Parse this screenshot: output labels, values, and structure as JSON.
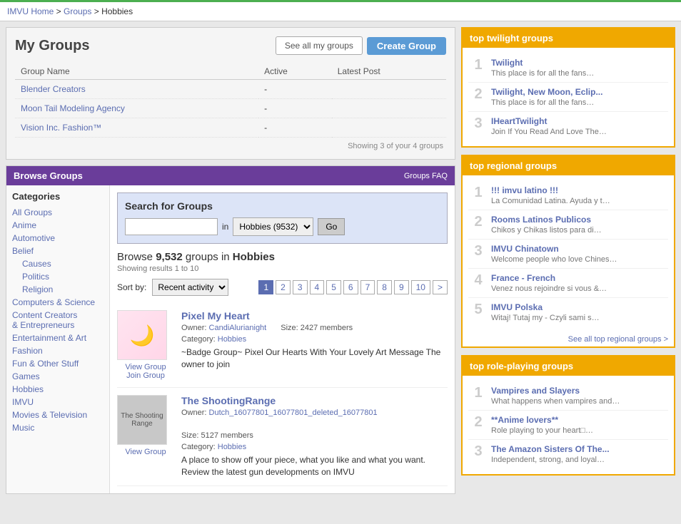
{
  "topbar_color": "#4caf50",
  "breadcrumb": {
    "home": "IMVU Home",
    "groups": "Groups",
    "current": "Hobbies"
  },
  "my_groups": {
    "title": "My Groups",
    "btn_see_all": "See all my groups",
    "btn_create": "Create Group",
    "table": {
      "col_name": "Group Name",
      "col_active": "Active",
      "col_latest": "Latest Post",
      "rows": [
        {
          "name": "Blender Creators",
          "active": "-",
          "latest": ""
        },
        {
          "name": "Moon Tail Modeling Agency",
          "active": "-",
          "latest": ""
        },
        {
          "name": "Vision Inc. Fashion™",
          "active": "-",
          "latest": ""
        }
      ]
    },
    "showing": "Showing 3 of your 4 groups"
  },
  "browse": {
    "title": "Browse Groups",
    "faq": "Groups FAQ",
    "categories_title": "Categories",
    "categories": [
      {
        "label": "All Groups",
        "sub": false
      },
      {
        "label": "Anime",
        "sub": false
      },
      {
        "label": "Automotive",
        "sub": false
      },
      {
        "label": "Belief",
        "sub": false
      },
      {
        "label": "Causes",
        "sub": true
      },
      {
        "label": "Politics",
        "sub": true
      },
      {
        "label": "Religion",
        "sub": true
      },
      {
        "label": "Computers & Science",
        "sub": false
      },
      {
        "label": "Content Creators & Entrepreneurs",
        "sub": false
      },
      {
        "label": "Entertainment & Art",
        "sub": false
      },
      {
        "label": "Fashion",
        "sub": false
      },
      {
        "label": "Fun & Other Stuff",
        "sub": false
      },
      {
        "label": "Games",
        "sub": false
      },
      {
        "label": "Hobbies",
        "sub": false
      },
      {
        "label": "IMVU",
        "sub": false
      },
      {
        "label": "Movies & Television",
        "sub": false
      },
      {
        "label": "Music",
        "sub": false
      }
    ],
    "search": {
      "title": "Search for Groups",
      "placeholder": "",
      "in_label": "in",
      "category_selected": "Hobbies (9532)",
      "go_btn": "Go"
    },
    "results_title_prefix": "Browse",
    "results_count": "9,532",
    "results_category": "Hobbies",
    "results_showing": "Showing results 1 to 10",
    "sort_label": "Sort by:",
    "sort_option": "Recent activity",
    "pagination": [
      "1",
      "2",
      "3",
      "4",
      "5",
      "6",
      "7",
      "8",
      "9",
      "10",
      ">"
    ],
    "groups": [
      {
        "name": "Pixel My Heart",
        "owner_label": "Owner:",
        "owner": "CandiAlurianight",
        "category_label": "Category:",
        "category": "Hobbies",
        "size_label": "Size:",
        "size": "2427 members",
        "desc": "~Badge Group~ Pixel Our Hearts With Your Lovely Art Message The owner to join",
        "join_word": "join",
        "view_link": "View Group",
        "join_link": "Join Group",
        "thumb_type": "pixel"
      },
      {
        "name": "The ShootingRange",
        "owner_label": "Owner:",
        "owner": "Dutch_16077801_16077801_deleted_16077801",
        "category_label": "Category:",
        "category": "Hobbies",
        "size_label": "Size:",
        "size": "5127 members",
        "desc": "A place to show off your piece, what you like and what you want. Review the latest gun developments on IMVU",
        "view_link": "View Group",
        "join_link": "",
        "thumb_type": "shooting"
      }
    ]
  },
  "sidebar": {
    "twilight": {
      "header": "top twilight groups",
      "items": [
        {
          "rank": "1",
          "name": "Twilight",
          "desc": "This place is for all the fans…"
        },
        {
          "rank": "2",
          "name": "Twilight, New Moon, Eclip...",
          "desc": "This place is for all the fans…"
        },
        {
          "rank": "3",
          "name": "IHeartTwilight",
          "desc": "Join If You Read And Love The…"
        }
      ]
    },
    "regional": {
      "header": "top regional groups",
      "items": [
        {
          "rank": "1",
          "name": "!!! imvu latino !!!",
          "desc": "La Comunidad Latina. Ayuda y t…"
        },
        {
          "rank": "2",
          "name": "Rooms Latinos Publicos",
          "desc": "Chikos y Chikas listos para di…"
        },
        {
          "rank": "3",
          "name": "IMVU Chinatown",
          "desc": "Welcome people who love Chines…"
        },
        {
          "rank": "4",
          "name": "France - French",
          "desc": "Venez nous rejoindre si vous &…"
        },
        {
          "rank": "5",
          "name": "IMVU Polska",
          "desc": "Witaj! Tutaj my - Czyli sami s…"
        }
      ],
      "see_all": "See all top regional groups >"
    },
    "roleplaying": {
      "header": "top role-playing groups",
      "items": [
        {
          "rank": "1",
          "name": "Vampires and Slayers",
          "desc": "What happens when vampires and…"
        },
        {
          "rank": "2",
          "name": "**Anime lovers**",
          "desc": "Role playing to your heart□…"
        },
        {
          "rank": "3",
          "name": "The Amazon Sisters Of The...",
          "desc": "Independent, strong, and loyal…"
        }
      ]
    }
  }
}
